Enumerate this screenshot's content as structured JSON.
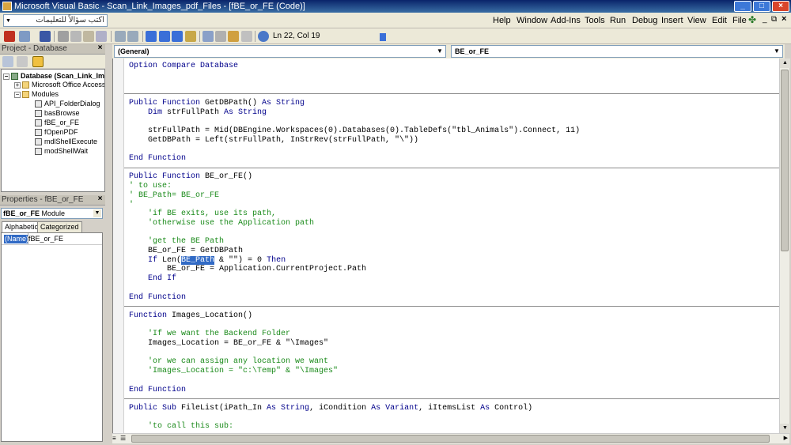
{
  "window": {
    "title": "Microsoft Visual Basic - Scan_Link_Images_pdf_Files - [fBE_or_FE (Code)]"
  },
  "menu": {
    "ask_placeholder": "اكتب سؤالاً للتعليمات",
    "items": [
      "Help",
      "Window",
      "Add-Ins",
      "Tools",
      "Run",
      "Debug",
      "Insert",
      "View",
      "Edit",
      "File"
    ]
  },
  "toolbar": {
    "position": "Ln 22, Col 19"
  },
  "project": {
    "title": "Project - Database",
    "tree": [
      "Database (Scan_Link_Im",
      "Microsoft Office Access C",
      "Modules",
      "API_FolderDialog",
      "basBrowse",
      "fBE_or_FE",
      "fOpenPDF",
      "mdlShellExecute",
      "modShellWait"
    ]
  },
  "properties": {
    "title": "Properties - fBE_or_FE",
    "object": "fBE_or_FE",
    "object_type": "Module",
    "tabs": [
      "Alphabetic",
      "Categorized"
    ],
    "name_key": "(Name)",
    "name_value": "fBE_or_FE"
  },
  "code": {
    "object_combo": "(General)",
    "proc_combo": "BE_or_FE",
    "lines": [
      {
        "parts": [
          [
            "kw",
            "Option Compare Database"
          ]
        ]
      },
      {
        "parts": []
      },
      {
        "parts": []
      },
      {
        "parts": []
      },
      {
        "parts": [
          [
            "kw",
            "Public Function "
          ],
          [
            "",
            "GetDBPath() "
          ],
          [
            "kw",
            "As String"
          ]
        ]
      },
      {
        "parts": [
          [
            "kw",
            "    Dim "
          ],
          [
            "",
            "strFullPath "
          ],
          [
            "kw",
            "As String"
          ]
        ]
      },
      {
        "parts": []
      },
      {
        "parts": [
          [
            "",
            "    strFullPath = Mid(DBEngine.Workspaces(0).Databases(0).TableDefs(\"tbl_Animals\").Connect, 11)"
          ]
        ]
      },
      {
        "parts": [
          [
            "",
            "    GetDBPath = Left(strFullPath, InStrRev(strFullPath, \"\\\"))"
          ]
        ]
      },
      {
        "parts": []
      },
      {
        "parts": [
          [
            "kw",
            "End Function"
          ]
        ]
      },
      {
        "parts": []
      },
      {
        "parts": [
          [
            "kw",
            "Public Function "
          ],
          [
            "",
            "BE_or_FE()"
          ]
        ]
      },
      {
        "parts": [
          [
            "cm",
            "' to use:"
          ]
        ]
      },
      {
        "parts": [
          [
            "cm",
            "' BE_Path= BE_or_FE"
          ]
        ]
      },
      {
        "parts": [
          [
            "cm",
            "'"
          ]
        ]
      },
      {
        "parts": [
          [
            "cm",
            "    'if BE exits, use its path,"
          ]
        ]
      },
      {
        "parts": [
          [
            "cm",
            "    'otherwise use the Application path"
          ]
        ]
      },
      {
        "parts": []
      },
      {
        "parts": [
          [
            "cm",
            "    'get the BE Path"
          ]
        ]
      },
      {
        "parts": [
          [
            "",
            "    BE_or_FE = GetDBPath"
          ]
        ]
      },
      {
        "parts": [
          [
            "kw",
            "    If "
          ],
          [
            "",
            "Len("
          ],
          [
            "sel",
            "BE_Path"
          ],
          [
            "",
            " & \"\") = 0 "
          ],
          [
            "kw",
            "Then"
          ]
        ]
      },
      {
        "parts": [
          [
            "",
            "        BE_or_FE = Application.CurrentProject.Path"
          ]
        ]
      },
      {
        "parts": [
          [
            "kw",
            "    End If"
          ]
        ]
      },
      {
        "parts": []
      },
      {
        "parts": [
          [
            "kw",
            "End Function"
          ]
        ]
      },
      {
        "parts": []
      },
      {
        "parts": [
          [
            "kw",
            "Function "
          ],
          [
            "",
            "Images_Location()"
          ]
        ]
      },
      {
        "parts": []
      },
      {
        "parts": [
          [
            "cm",
            "    'If we want the Backend Folder"
          ]
        ]
      },
      {
        "parts": [
          [
            "",
            "    Images_Location = BE_or_FE & \"\\Images\""
          ]
        ]
      },
      {
        "parts": []
      },
      {
        "parts": [
          [
            "cm",
            "    'or we can assign any location we want"
          ]
        ]
      },
      {
        "parts": [
          [
            "cm",
            "    'Images_Location = \"c:\\Temp\" & \"\\Images\""
          ]
        ]
      },
      {
        "parts": []
      },
      {
        "parts": [
          [
            "kw",
            "End Function"
          ]
        ]
      },
      {
        "parts": []
      },
      {
        "parts": [
          [
            "kw",
            "Public Sub "
          ],
          [
            "",
            "FileList(iPath_In "
          ],
          [
            "kw",
            "As String"
          ],
          [
            "",
            ", iCondition "
          ],
          [
            "kw",
            "As Variant"
          ],
          [
            "",
            ", iItemsList "
          ],
          [
            "kw",
            "As "
          ],
          [
            "",
            "Control)"
          ]
        ]
      },
      {
        "parts": []
      },
      {
        "parts": [
          [
            "cm",
            "    'to call this sub:"
          ]
        ]
      }
    ]
  }
}
